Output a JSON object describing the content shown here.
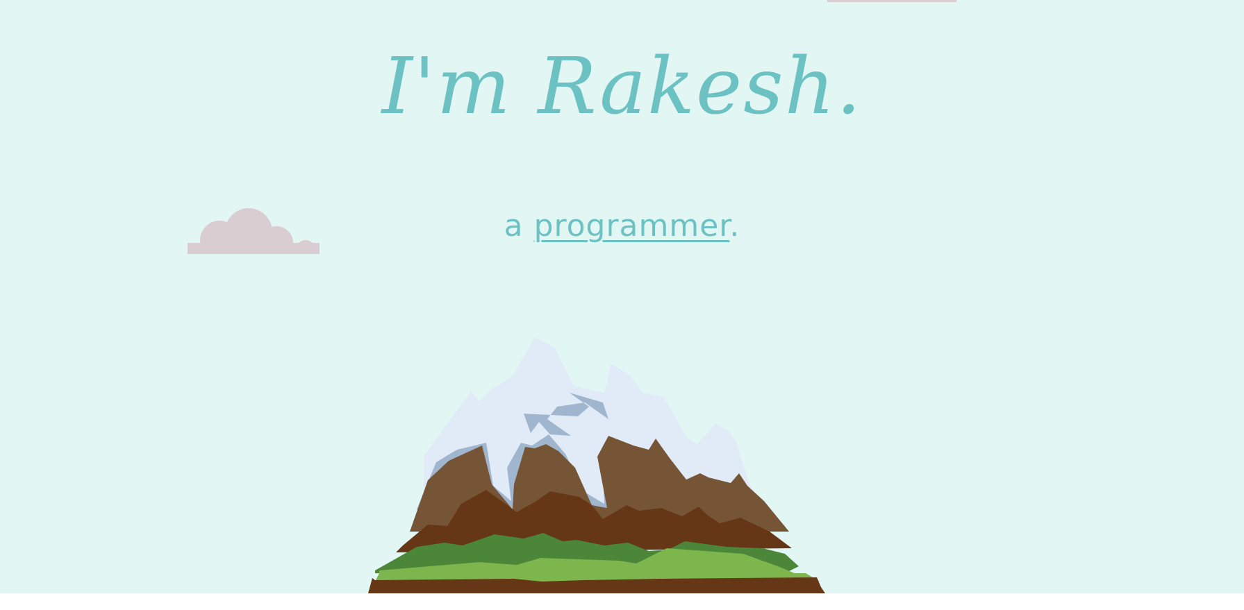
{
  "header": {
    "title": "I'm Rakesh."
  },
  "tagline": {
    "prefix": "a ",
    "role": "programmer",
    "suffix": "."
  },
  "colors": {
    "background": "#e2f6f3",
    "accent": "#6cc2c2",
    "cloud": "#d9cdd2"
  }
}
